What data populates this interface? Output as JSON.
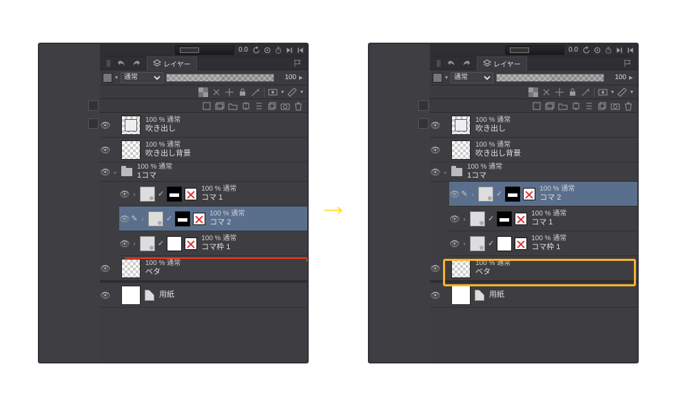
{
  "nav": {
    "zoom": "0.0"
  },
  "tabbar": {
    "layer_label": "レイヤー"
  },
  "blend": {
    "mode": "通常",
    "opacity": "100"
  },
  "left": {
    "layers": [
      {
        "mode": "100 % 通常",
        "name": "吹き出し"
      },
      {
        "mode": "100 % 通常",
        "name": "吹き出し背景"
      },
      {
        "mode": "100 % 通常",
        "name": "1コマ"
      }
    ],
    "frames": [
      {
        "mode": "100 % 通常",
        "name": "コマ 1"
      },
      {
        "mode": "100 % 通常",
        "name": "コマ 2"
      },
      {
        "mode": "100 % 通常",
        "name": "コマ枠 1"
      }
    ],
    "bottom": [
      {
        "mode": "100 % 通常",
        "name": "ベタ"
      },
      {
        "mode": "",
        "name": "用紙"
      }
    ]
  },
  "right": {
    "layers": [
      {
        "mode": "100 % 通常",
        "name": "吹き出し"
      },
      {
        "mode": "100 % 通常",
        "name": "吹き出し背景"
      },
      {
        "mode": "100 % 通常",
        "name": "1コマ"
      }
    ],
    "frames": [
      {
        "mode": "100 % 通常",
        "name": "コマ 2"
      },
      {
        "mode": "100 % 通常",
        "name": "コマ 1"
      },
      {
        "mode": "100 % 通常",
        "name": "コマ枠 1"
      }
    ],
    "bottom": [
      {
        "mode": "100 % 通常",
        "name": "ベタ"
      },
      {
        "mode": "",
        "name": "用紙"
      }
    ]
  }
}
